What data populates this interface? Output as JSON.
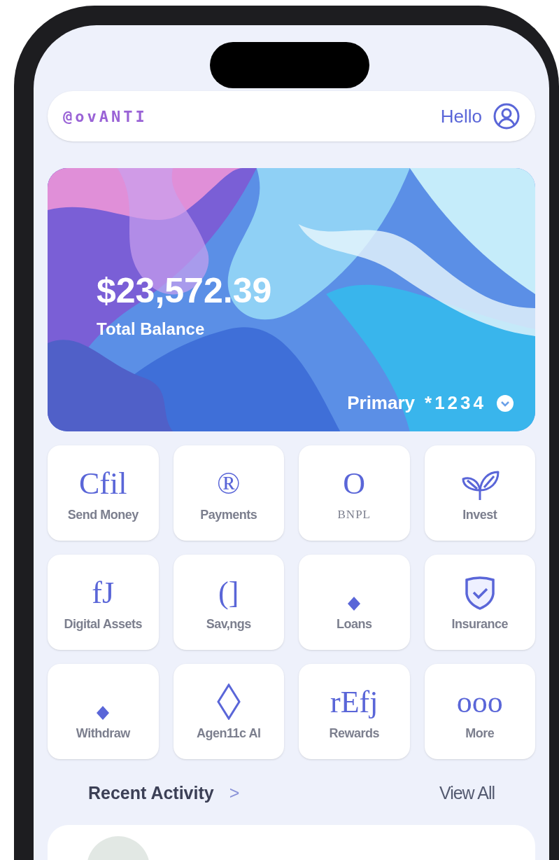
{
  "header": {
    "logo": "@ovANTI",
    "greeting": "Hello"
  },
  "balance_card": {
    "amount": "$23,572.39",
    "label": "Total Balance",
    "account": "Primary",
    "account_number": "*1234"
  },
  "actions": [
    {
      "label": "Send Money",
      "icon": {
        "kind": "glyph",
        "text": "Cfil"
      },
      "serif_label": false
    },
    {
      "label": "Payments",
      "icon": {
        "kind": "glyph",
        "text": "®"
      },
      "serif_label": false
    },
    {
      "label": "BNPL",
      "icon": {
        "kind": "glyph",
        "text": "O"
      },
      "serif_label": true
    },
    {
      "label": "Invest",
      "icon": {
        "kind": "leaf"
      },
      "serif_label": false
    },
    {
      "label": "Digital Assets",
      "icon": {
        "kind": "glyph",
        "text": "fJ"
      },
      "serif_label": false
    },
    {
      "label": "Sav,ngs",
      "icon": {
        "kind": "glyph",
        "text": "(]"
      },
      "serif_label": false
    },
    {
      "label": "Loans",
      "icon": {
        "kind": "diamond"
      },
      "serif_label": false
    },
    {
      "label": "Insurance",
      "icon": {
        "kind": "shield"
      },
      "serif_label": false
    },
    {
      "label": "Withdraw",
      "icon": {
        "kind": "diamond"
      },
      "serif_label": false
    },
    {
      "label": "Agen11c Al",
      "icon": {
        "kind": "outline-diamond"
      },
      "serif_label": false
    },
    {
      "label": "Rewards",
      "icon": {
        "kind": "glyph",
        "text": "rEfj"
      },
      "serif_label": false
    },
    {
      "label": "More",
      "icon": {
        "kind": "glyph",
        "text": "ooo"
      },
      "serif_label": false
    }
  ],
  "recent_activity": {
    "title": "Recent Activity",
    "arrow": ">",
    "view_all": "View All"
  }
}
